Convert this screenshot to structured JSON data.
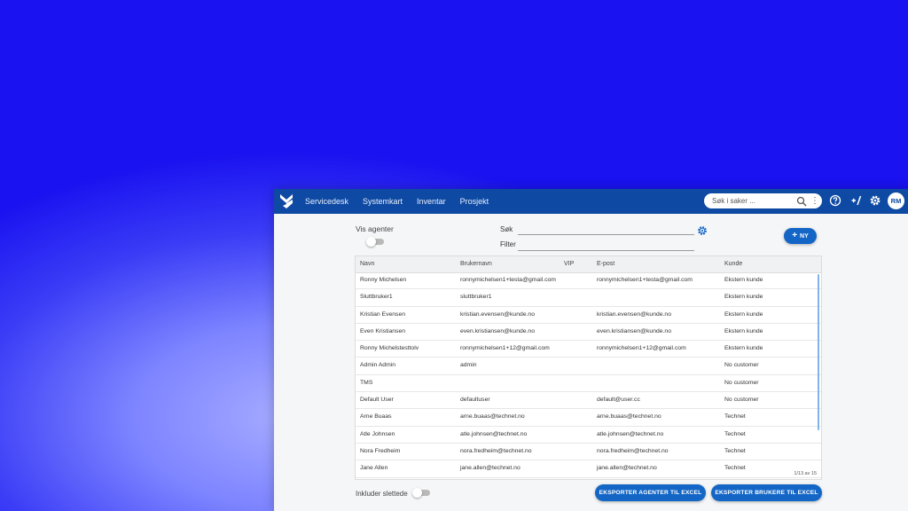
{
  "topbar": {
    "nav": [
      "Servicedesk",
      "Systemkart",
      "Inventar",
      "Prosjekt"
    ],
    "search_placeholder": "Søk i saker ...",
    "user_initials": "RM"
  },
  "controls": {
    "vis_agenter_label": "Vis agenter",
    "sok_label": "Søk",
    "filter_label": "Filter",
    "new_button_label": "NY"
  },
  "table": {
    "columns": [
      "Navn",
      "Brukernavn",
      "VIP",
      "E-post",
      "Kunde"
    ],
    "rows": [
      [
        "Ronny Michelsen",
        "ronnymichelsen1+testa@gmail.com",
        "",
        "ronnymichelsen1+testa@gmail.com",
        "Ekstern kunde"
      ],
      [
        "Sluttbruker1",
        "sluttbruker1",
        "",
        "",
        "Ekstern kunde"
      ],
      [
        "Kristian Evensen",
        "kristian.evensen@kunde.no",
        "",
        "kristian.evensen@kunde.no",
        "Ekstern kunde"
      ],
      [
        "Even Kristiansen",
        "even.kristiansen@kunde.no",
        "",
        "even.kristiansen@kunde.no",
        "Ekstern kunde"
      ],
      [
        "Ronny Michelstesttolv",
        "ronnymichelsen1+12@gmail.com",
        "",
        "ronnymichelsen1+12@gmail.com",
        "Ekstern kunde"
      ],
      [
        "Admin Admin",
        "admin",
        "",
        "",
        "No customer"
      ],
      [
        "TMS",
        "",
        "",
        "",
        "No customer"
      ],
      [
        "Default User",
        "defaultuser",
        "",
        "default@user.cc",
        "No customer"
      ],
      [
        "Arne Buaas",
        "arne.buaas@technet.no",
        "",
        "arne.buaas@technet.no",
        "Technet"
      ],
      [
        "Atle Johnsen",
        "atle.johnsen@technet.no",
        "",
        "atle.johnsen@technet.no",
        "Technet"
      ],
      [
        "Nora Fredheim",
        "nora.fredheim@technet.no",
        "",
        "nora.fredheim@technet.no",
        "Technet"
      ],
      [
        "Jane Allen",
        "jane.allen@technet.no",
        "",
        "jane.allen@technet.no",
        "Technet"
      ]
    ],
    "pager": "1/13 av 15"
  },
  "footer": {
    "inkluder_label": "Inkluder slettede",
    "export_agents_label": "EKSPORTER AGENTER TIL EXCEL",
    "export_users_label": "EKSPORTER BRUKERE TIL EXCEL"
  },
  "colors": {
    "topbar": "#0e4aa3",
    "primary_button": "#1366c6",
    "background_blue": "#1a12f0"
  }
}
